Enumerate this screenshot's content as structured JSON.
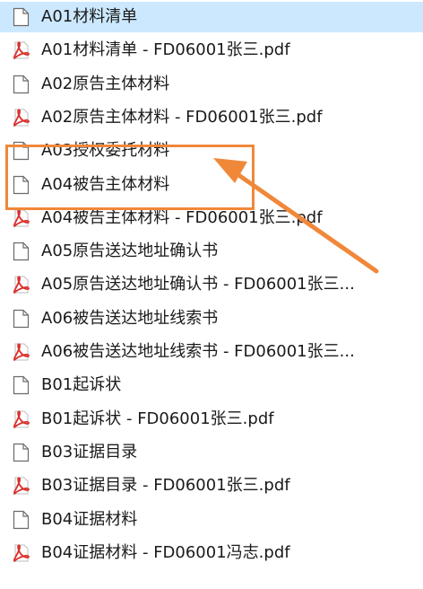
{
  "files": [
    {
      "name": "A01材料清单",
      "type": "document",
      "selected": true
    },
    {
      "name": "A01材料清单 - FD06001张三.pdf",
      "type": "pdf"
    },
    {
      "name": "A02原告主体材料",
      "type": "document"
    },
    {
      "name": "A02原告主体材料 - FD06001张三.pdf",
      "type": "pdf"
    },
    {
      "name": "A03授权委托材料",
      "type": "document"
    },
    {
      "name": "A04被告主体材料",
      "type": "document"
    },
    {
      "name": "A04被告主体材料 - FD06001张三.pdf",
      "type": "pdf"
    },
    {
      "name": "A05原告送达地址确认书",
      "type": "document"
    },
    {
      "name": "A05原告送达地址确认书 - FD06001张三...",
      "type": "pdf"
    },
    {
      "name": "A06被告送达地址线索书",
      "type": "document"
    },
    {
      "name": "A06被告送达地址线索书 - FD06001张三...",
      "type": "pdf"
    },
    {
      "name": "B01起诉状",
      "type": "document"
    },
    {
      "name": "B01起诉状 - FD06001张三.pdf",
      "type": "pdf"
    },
    {
      "name": "B03证据目录",
      "type": "document"
    },
    {
      "name": "B03证据目录 - FD06001张三.pdf",
      "type": "pdf"
    },
    {
      "name": "B04证据材料",
      "type": "document"
    },
    {
      "name": "B04证据材料 - FD06001冯志.pdf",
      "type": "pdf"
    }
  ],
  "colors": {
    "selection": "#cce8ff",
    "highlight": "#f0883a",
    "pdf_red": "#d9302c"
  }
}
